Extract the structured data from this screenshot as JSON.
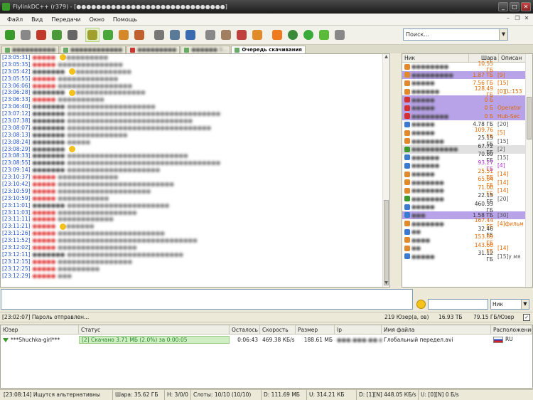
{
  "window": {
    "title": "FlylinkDC++ (r379) - [●●●●●●●●●●●●●●●●●●●●●●●●●●●●●●]"
  },
  "menu": [
    "Файл",
    "Вид",
    "Передачи",
    "Окно",
    "Помощь"
  ],
  "search": {
    "value": "Поиск..."
  },
  "tabs": [
    {
      "label": "●●●●●●●●●●",
      "active": false
    },
    {
      "label": "●●●●●●●●●●●●",
      "active": false
    },
    {
      "label": "●●●●●●●●●",
      "active": false
    },
    {
      "label": "●●●●●●  3...",
      "active": false
    },
    {
      "label": "Очередь скачивания",
      "active": true
    }
  ],
  "chat": [
    {
      "ts": "[23:05:31]",
      "nick": "●●●●●",
      "msg": "●●●●●●●●●",
      "emo": true
    },
    {
      "ts": "[23:05:35]",
      "nick": "●●●●●",
      "msg": "●●●●●●●●●●●●●●"
    },
    {
      "ts": "[23:05:42]",
      "nick": "●●●●●●●",
      "msg": "●●●●●●●●●●●●",
      "plain": true,
      "emo": true
    },
    {
      "ts": "[23:05:55]",
      "nick": "●●●●●",
      "msg": "●●●●●●●●●●●●●"
    },
    {
      "ts": "[23:06:06]",
      "nick": "●●●●●",
      "msg": "●●●●●●●●●●●●●●●●"
    },
    {
      "ts": "[23:06:28]",
      "nick": "●●●●●●●",
      "msg": "●●●●●●●●●●●●●●●",
      "plain": true,
      "emo": true
    },
    {
      "ts": "[23:06:33]",
      "nick": "●●●●●",
      "msg": "●●●●●●●●●●"
    },
    {
      "ts": "[23:06:40]",
      "nick": "●●●●●●●",
      "msg": "●●●●●●●●●●●●●●●●●●●",
      "plain": true
    },
    {
      "ts": "[23:07:12]",
      "nick": "●●●●●●●",
      "msg": "●●●●●●●●●●●●●●●●●●●●●●●●●●●●●●●●●",
      "plain": true
    },
    {
      "ts": "[23:07:38]",
      "nick": "●●●●●●●",
      "msg": "●●●●●●●●●●●●●●●●●●●●●●●●●●●",
      "plain": true
    },
    {
      "ts": "[23:08:07]",
      "nick": "●●●●●●●",
      "msg": "●●●●●●●●●●●●●●●●●●●●●●●●●●●●●●●",
      "plain": true
    },
    {
      "ts": "[23:08:13]",
      "nick": "●●●●●●●",
      "msg": "●●●●●●●●●●●●●",
      "plain": true
    },
    {
      "ts": "[23:08:24]",
      "nick": "●●●●●●●",
      "msg": "●●●●●",
      "plain": true
    },
    {
      "ts": "[23:08:29]",
      "nick": "●●●●●●●",
      "msg": "",
      "plain": true,
      "emo": true
    },
    {
      "ts": "[23:08:33]",
      "nick": "●●●●●●●",
      "msg": "●●●●●●●●●●●●●●●●●●●●●●●●●●",
      "plain": true
    },
    {
      "ts": "[23:08:55]",
      "nick": "●●●●●●●",
      "msg": "●●●●●●●●●●●●●●●●●●●●●●●●●●●●●●●●●",
      "plain": true
    },
    {
      "ts": "[23:09:14]",
      "nick": "●●●●●●●",
      "msg": "●●●●●●●●●●●●●●●●●●●●",
      "plain": true
    },
    {
      "ts": "[23:10:37]",
      "nick": "●●●●●",
      "msg": "●●●●●●●●●●●●●"
    },
    {
      "ts": "[23:10:42]",
      "nick": "●●●●●",
      "msg": "●●●●●●●●●●●●●●●●●●●●●●●●●"
    },
    {
      "ts": "[23:10:59]",
      "nick": "●●●●●",
      "msg": "●●●●●●●●●●●●●●●●●●●●"
    },
    {
      "ts": "[23:10:59]",
      "nick": "●●●●●",
      "msg": "●●●●●●●●●●●"
    },
    {
      "ts": "[23:11:01]",
      "nick": "●●●●●●●",
      "msg": "●●●●●●●●●●●●●●●●●●●●●●",
      "plain": true
    },
    {
      "ts": "[23:11:03]",
      "nick": "●●●●●",
      "msg": "●●●●●●●●●●●●●●●●●"
    },
    {
      "ts": "[23:11:11]",
      "nick": "●●●●●",
      "msg": "●●●●●●●●●●●●"
    },
    {
      "ts": "[23:11:21]",
      "nick": "●●●●●",
      "msg": "●●●●●●",
      "emo": true
    },
    {
      "ts": "[23:11:26]",
      "nick": "●●●●●",
      "msg": "●●●●●●●●●●●●●●●●●●●●●●●"
    },
    {
      "ts": "[23:11:52]",
      "nick": "●●●●●",
      "msg": "●●●●●●●●●●●●●●●●●●●●●●●●●●●●●●"
    },
    {
      "ts": "[23:12:02]",
      "nick": "●●●●●",
      "msg": "●●●●●●●●●●●●●●●●●"
    },
    {
      "ts": "[23:12:11]",
      "nick": "●●●●●●●",
      "msg": "●●●●●●●●●●●●●●●●●●●●●●●●●",
      "plain": true
    },
    {
      "ts": "[23:12:15]",
      "nick": "●●●●●",
      "msg": "●●●●●●●●●●●●●●●●"
    },
    {
      "ts": "[23:12:25]",
      "nick": "●●●●●",
      "msg": "●●●●●●●●●"
    },
    {
      "ts": "[23:12:29]",
      "nick": "●●●●●",
      "msg": "●●●"
    }
  ],
  "users": {
    "columns": [
      "Ник",
      "Шара",
      "Описан"
    ],
    "rows": [
      {
        "name": "●●●●●●●●",
        "share": "10.55 ГБ",
        "desc": "",
        "style": "orange",
        "icon": "#e08a2a"
      },
      {
        "name": "●●●●●●●●●",
        "share": "1.87 ТБ",
        "desc": "[9]",
        "style": "op orange",
        "icon": "#e08a2a"
      },
      {
        "name": "●●●●●",
        "share": "7.56 ГБ",
        "desc": "[15]",
        "style": "orange",
        "icon": "#e08a2a"
      },
      {
        "name": "●●●●●●",
        "share": "128.49 ГБ",
        "desc": "[0][L:153",
        "style": "orange",
        "icon": "#e08a2a"
      },
      {
        "name": "●●●●●",
        "share": "0 Б",
        "desc": "",
        "style": "op orange",
        "icon": "#d43030"
      },
      {
        "name": "●●●●●",
        "share": "0 Б",
        "desc": "Operator",
        "style": "op orange",
        "icon": "#d43030"
      },
      {
        "name": "●●●●●●●●",
        "share": "0 Б",
        "desc": "Hub-Sec",
        "style": "op orange",
        "icon": "#d43030"
      },
      {
        "name": "●●●●●",
        "share": "4.78 ГБ",
        "desc": "[20]",
        "style": "",
        "icon": "#3a7ad0"
      },
      {
        "name": "●●●●●",
        "share": "109.76 ГБ",
        "desc": "[5]",
        "style": "orange",
        "icon": "#e08a2a"
      },
      {
        "name": "●●●●●●●",
        "share": "25.15 ГБ",
        "desc": "[15]",
        "style": "",
        "icon": "#e08a2a"
      },
      {
        "name": "●●●●●●●●●●",
        "share": "67.72 ГБ",
        "desc": "[2]",
        "style": "hl",
        "icon": "#3a9a2a"
      },
      {
        "name": "●●●●●●",
        "share": "70.89 ГБ",
        "desc": "[15]",
        "style": "",
        "icon": "#3a7ad0"
      },
      {
        "name": "●●●●●●",
        "share": "93.27 ГБ",
        "desc": "[4]",
        "style": "purple",
        "icon": "#3a7ad0"
      },
      {
        "name": "●●●●●",
        "share": "25.51 ГБ",
        "desc": "[14]",
        "style": "orange",
        "icon": "#e08a2a"
      },
      {
        "name": "●●●●●●●",
        "share": "65.84 ГБ",
        "desc": "[14]",
        "style": "orange",
        "icon": "#e08a2a"
      },
      {
        "name": "●●●●●●●",
        "share": "71.00 ГБ",
        "desc": "[14]",
        "style": "orange",
        "icon": "#e08a2a"
      },
      {
        "name": "●●●●●●●",
        "share": "22.15 ГБ",
        "desc": "[20]",
        "style": "",
        "icon": "#3a9a2a"
      },
      {
        "name": "●●●●●",
        "share": "460.33 ГБ",
        "desc": "",
        "style": "",
        "icon": "#3a7ad0"
      },
      {
        "name": "●●●",
        "share": "1.58 ТБ",
        "desc": "[30]",
        "style": "op",
        "icon": "#3a7ad0"
      },
      {
        "name": "●●●●●●●",
        "share": "167.44 ГБ",
        "desc": "[4]фильм",
        "style": "orange",
        "icon": "#e08a2a"
      },
      {
        "name": "●●",
        "share": "32.46 ГБ",
        "desc": "",
        "style": "",
        "icon": "#3a7ad0"
      },
      {
        "name": "●●●●",
        "share": "153.89 ГБ",
        "desc": "",
        "style": "orange",
        "icon": "#e08a2a"
      },
      {
        "name": "●●",
        "share": "143.60 ГБ",
        "desc": "[14]",
        "style": "orange",
        "icon": "#e08a2a"
      },
      {
        "name": "●●●●●",
        "share": "31.12 ГБ",
        "desc": "[15]у мя",
        "style": "",
        "icon": "#3a7ad0"
      }
    ]
  },
  "chat_input": {
    "nick_select": "Ник"
  },
  "hub_status": {
    "message": "[23:02:07] Пароль отправлен...",
    "users": "219 Юзер(а, ов)",
    "total_share": "16.93 ТБ",
    "per_user": "79.15 ГБ/Юзер"
  },
  "queue": {
    "columns": [
      "Юзер",
      "Статус",
      "Осталось",
      "Скорость",
      "Размер",
      "Ip",
      "Имя файла",
      "Расположение"
    ],
    "rows": [
      {
        "user": "***Shuchka-girl***",
        "status": "[2] Скачано 3.71 МБ (2.0%) за 0:00:05",
        "remaining": "0:06:43",
        "speed": "469.38 КБ/s",
        "size": "188.61 МБ",
        "ip": "●●●.●●●.●●.●●●",
        "filename": "Глобальный передел.avi",
        "location": "RU",
        "progress": 0.02
      }
    ]
  },
  "statusbar": {
    "message": "[23:08:14] Ищутся альтернативны",
    "share": "Шара: 35.62 ГБ",
    "hubs": "H: 3/0/0",
    "slots": "Слоты: 10/10 (10/10)",
    "download": "D: 111.69 МБ",
    "upload": "U: 314.21 КБ",
    "dl_speed": "D: [1][N] 448.05 КБ/s",
    "ul_speed": "U: [0][N] 0 Б/s"
  },
  "colors": {
    "timestamp": "#2255cc",
    "nick": "#e03030",
    "operator_row": "#b8a3e8",
    "share_orange": "#e06800",
    "progress_fill": "#cfeec4"
  },
  "toolbar_icons": [
    "reconnect-icon",
    "follow-redirect-icon",
    "favorite-hubs-icon",
    "favorite-users-icon",
    "public-hubs-icon",
    "download-queue-icon",
    "finished-downloads-icon",
    "upload-queue-icon",
    "finished-uploads-icon",
    "search-icon",
    "adl-search-icon",
    "search-spy-icon",
    "network-stats-icon",
    "notepad-icon",
    "open-file-list-icon",
    "recents-icon",
    "settings-icon",
    "away-icon",
    "limiter-icon",
    "skin-icon",
    "disconnect-icon"
  ]
}
